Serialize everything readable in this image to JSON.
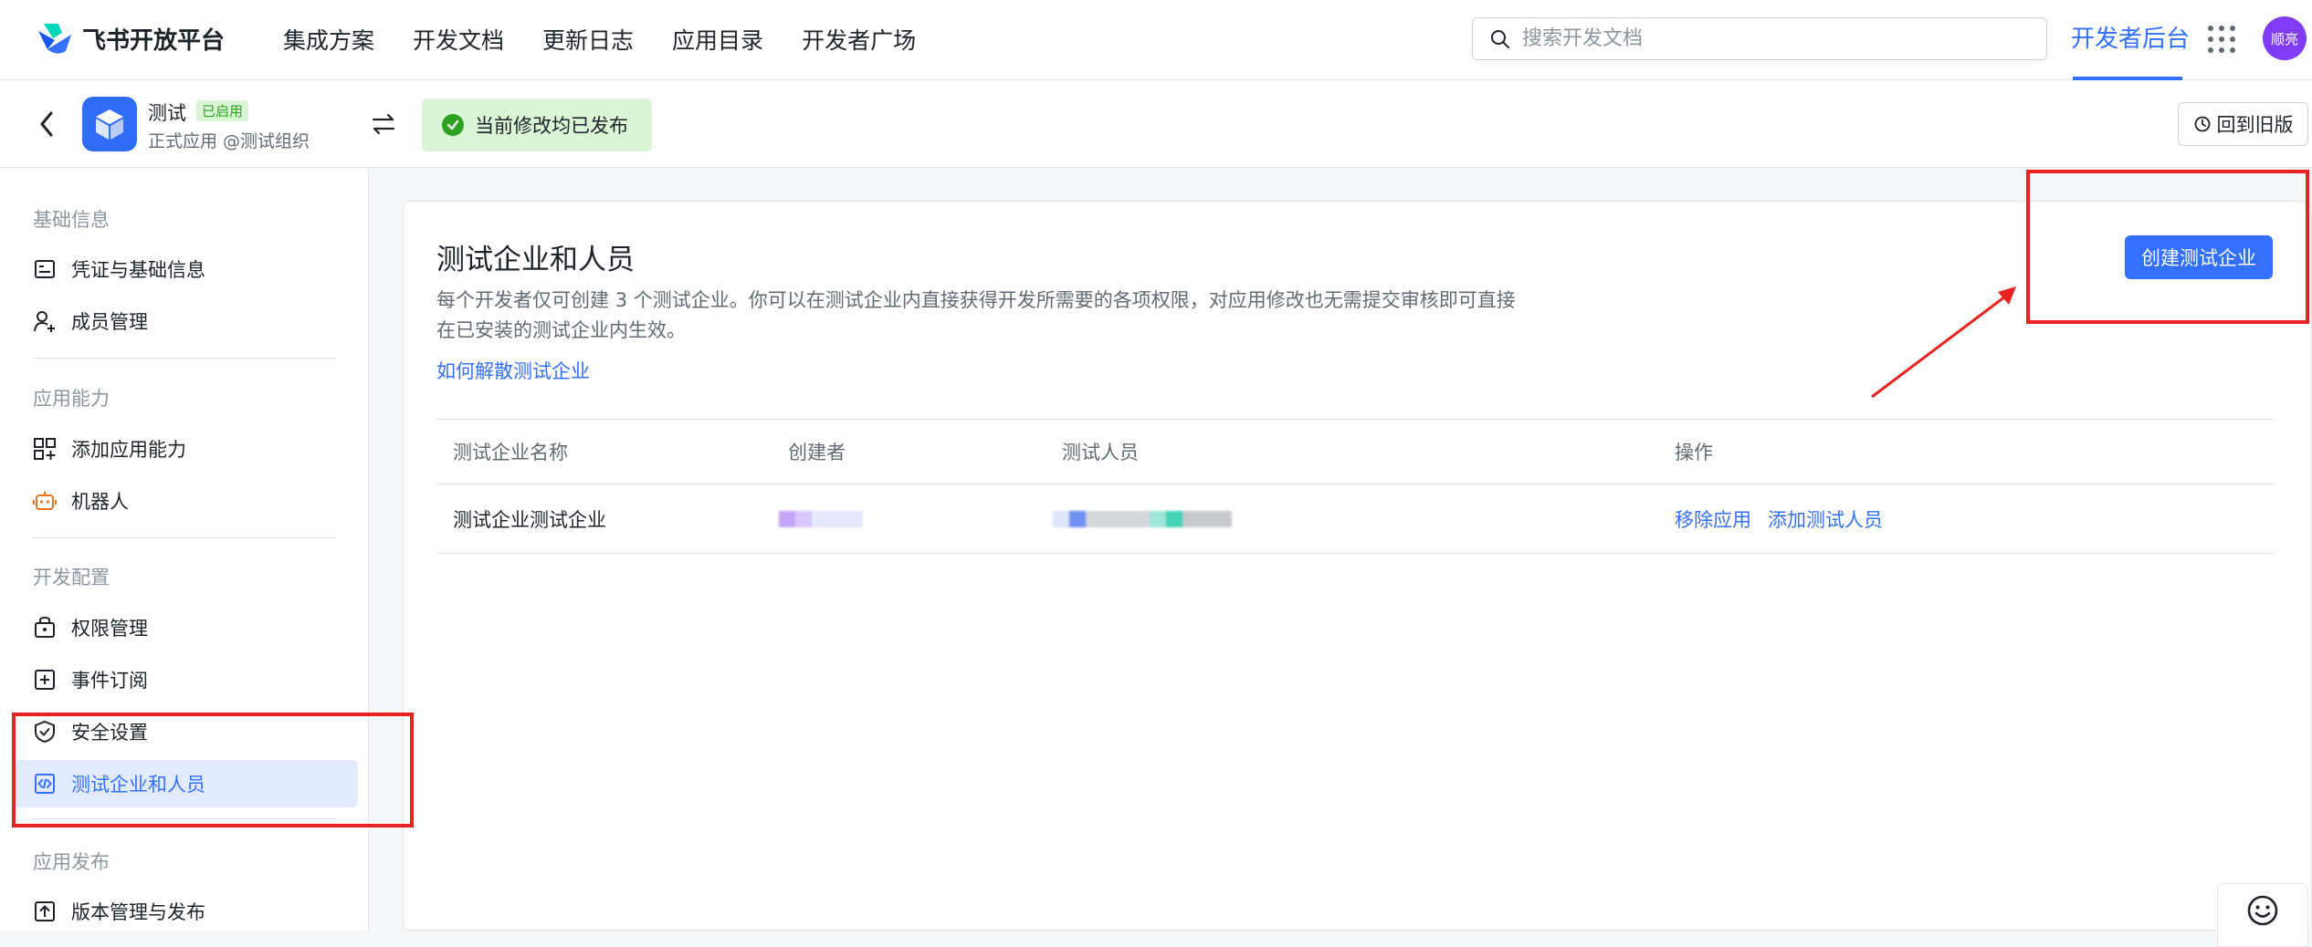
{
  "topnav": {
    "brand": "飞书开放平台",
    "links": [
      "集成方案",
      "开发文档",
      "更新日志",
      "应用目录",
      "开发者广场"
    ],
    "search_placeholder": "搜索开发文档",
    "console_label": "开发者后台",
    "avatar_text": "顺亮"
  },
  "appbar": {
    "app_name": "测试",
    "app_badge": "已启用",
    "app_subtitle": "正式应用 @测试组织",
    "status_text": "当前修改均已发布",
    "rollback_label": "回到旧版"
  },
  "sidebar": {
    "groups": [
      "基础信息",
      "应用能力",
      "开发配置",
      "应用发布"
    ],
    "items": [
      {
        "label": "凭证与基础信息",
        "icon": "id-card-icon"
      },
      {
        "label": "成员管理",
        "icon": "user-add-icon"
      },
      {
        "label": "添加应用能力",
        "icon": "grid-add-icon"
      },
      {
        "label": "机器人",
        "icon": "robot-icon"
      },
      {
        "label": "权限管理",
        "icon": "lock-box-icon"
      },
      {
        "label": "事件订阅",
        "icon": "event-add-icon"
      },
      {
        "label": "安全设置",
        "icon": "shield-icon"
      },
      {
        "label": "测试企业和人员",
        "icon": "code-icon",
        "active": true
      },
      {
        "label": "版本管理与发布",
        "icon": "upload-icon"
      }
    ]
  },
  "main": {
    "title": "测试企业和人员",
    "description": "每个开发者仅可创建 3 个测试企业。你可以在测试企业内直接获得开发所需要的各项权限，对应用修改也无需提交审核即可直接在已安装的测试企业内生效。",
    "link_text": "如何解散测试企业",
    "create_button": "创建测试企业",
    "table": {
      "headers": [
        "测试企业名称",
        "创建者",
        "测试人员",
        "操作"
      ],
      "rows": [
        {
          "name": "测试企业测试企业",
          "actions": [
            "移除应用",
            "添加测试人员"
          ]
        }
      ]
    }
  },
  "colors": {
    "accent": "#3370ff",
    "annotation_red": "#e8231f",
    "success_green": "#2ea121"
  }
}
